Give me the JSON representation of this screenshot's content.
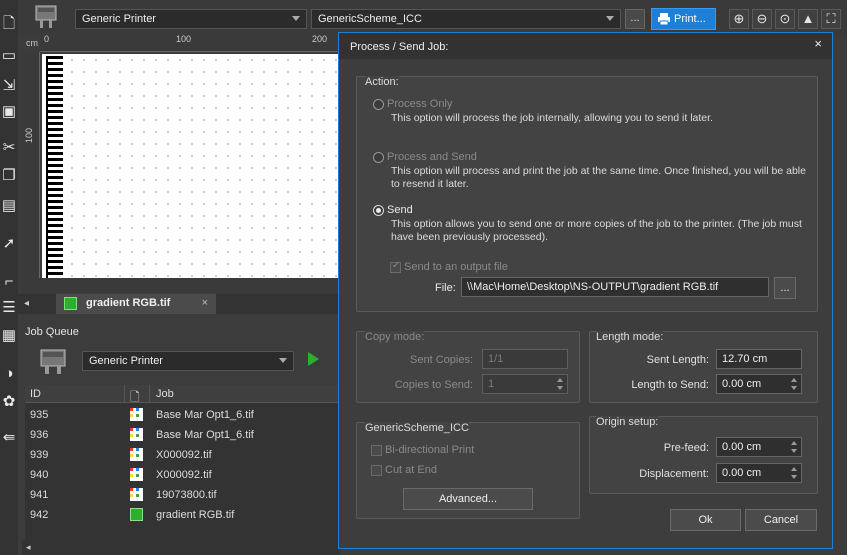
{
  "toolbar": {
    "printer": "Generic Printer",
    "scheme": "GenericScheme_ICC",
    "more": "...",
    "print": "Print...",
    "zoom_icons": [
      "zoom-in-icon",
      "zoom-out-icon",
      "zoom-fit-icon",
      "shapes-icon",
      "selection-icon"
    ]
  },
  "ruler": {
    "unit": "cm",
    "top_ticks": [
      "0",
      "100",
      "200"
    ],
    "left_ticks": [
      "100"
    ]
  },
  "tab": {
    "label": "gradient RGB.tif",
    "close": "×"
  },
  "job_queue": {
    "title": "Job Queue",
    "printer": "Generic Printer",
    "columns": [
      "ID",
      "Job"
    ],
    "rows": [
      {
        "id": "935",
        "job": "Base Mar Opt1_6.tif",
        "icon": "color"
      },
      {
        "id": "936",
        "job": "Base Mar Opt1_6.tif",
        "icon": "color"
      },
      {
        "id": "939",
        "job": "X000092.tif",
        "icon": "color"
      },
      {
        "id": "940",
        "job": "X000092.tif",
        "icon": "color"
      },
      {
        "id": "941",
        "job": "19073800.tif",
        "icon": "color"
      },
      {
        "id": "942",
        "job": "gradient RGB.tif",
        "icon": "green"
      }
    ]
  },
  "dialog": {
    "title": "Process / Send Job:",
    "close": "×",
    "action": {
      "title": "Action:",
      "options": [
        {
          "label": "Process Only",
          "desc": "This option will process the job internally, allowing you to send it later.",
          "selected": false
        },
        {
          "label": "Process and Send",
          "desc": "This option will process and print the job at the same time. Once finished, you will be able to resend it later.",
          "selected": false
        },
        {
          "label": "Send",
          "desc": "This option allows you to send one or more copies of the job to the printer. (The job must have been previously processed).",
          "selected": true
        }
      ],
      "output_checkbox": "Send to an output file",
      "file_label": "File:",
      "file_value": "\\\\Mac\\Home\\Desktop\\NS-OUTPUT\\gradient RGB.tif",
      "browse": "..."
    },
    "copy_mode": {
      "title": "Copy mode:",
      "sent_copies_label": "Sent Copies:",
      "sent_copies_value": "1/1",
      "copies_to_send_label": "Copies to Send:",
      "copies_to_send_value": "1"
    },
    "length_mode": {
      "title": "Length mode:",
      "sent_length_label": "Sent Length:",
      "sent_length_value": "12.70 cm",
      "length_to_send_label": "Length to Send:",
      "length_to_send_value": "0.00 cm"
    },
    "scheme": {
      "title": "GenericScheme_ICC",
      "bidirectional": "Bi-directional Print",
      "cut_at_end": "Cut at End",
      "advanced": "Advanced..."
    },
    "origin": {
      "title": "Origin setup:",
      "prefeed_label": "Pre-feed:",
      "prefeed_value": "0.00 cm",
      "displacement_label": "Displacement:",
      "displacement_value": "0.00 cm"
    },
    "ok": "Ok",
    "cancel": "Cancel"
  }
}
